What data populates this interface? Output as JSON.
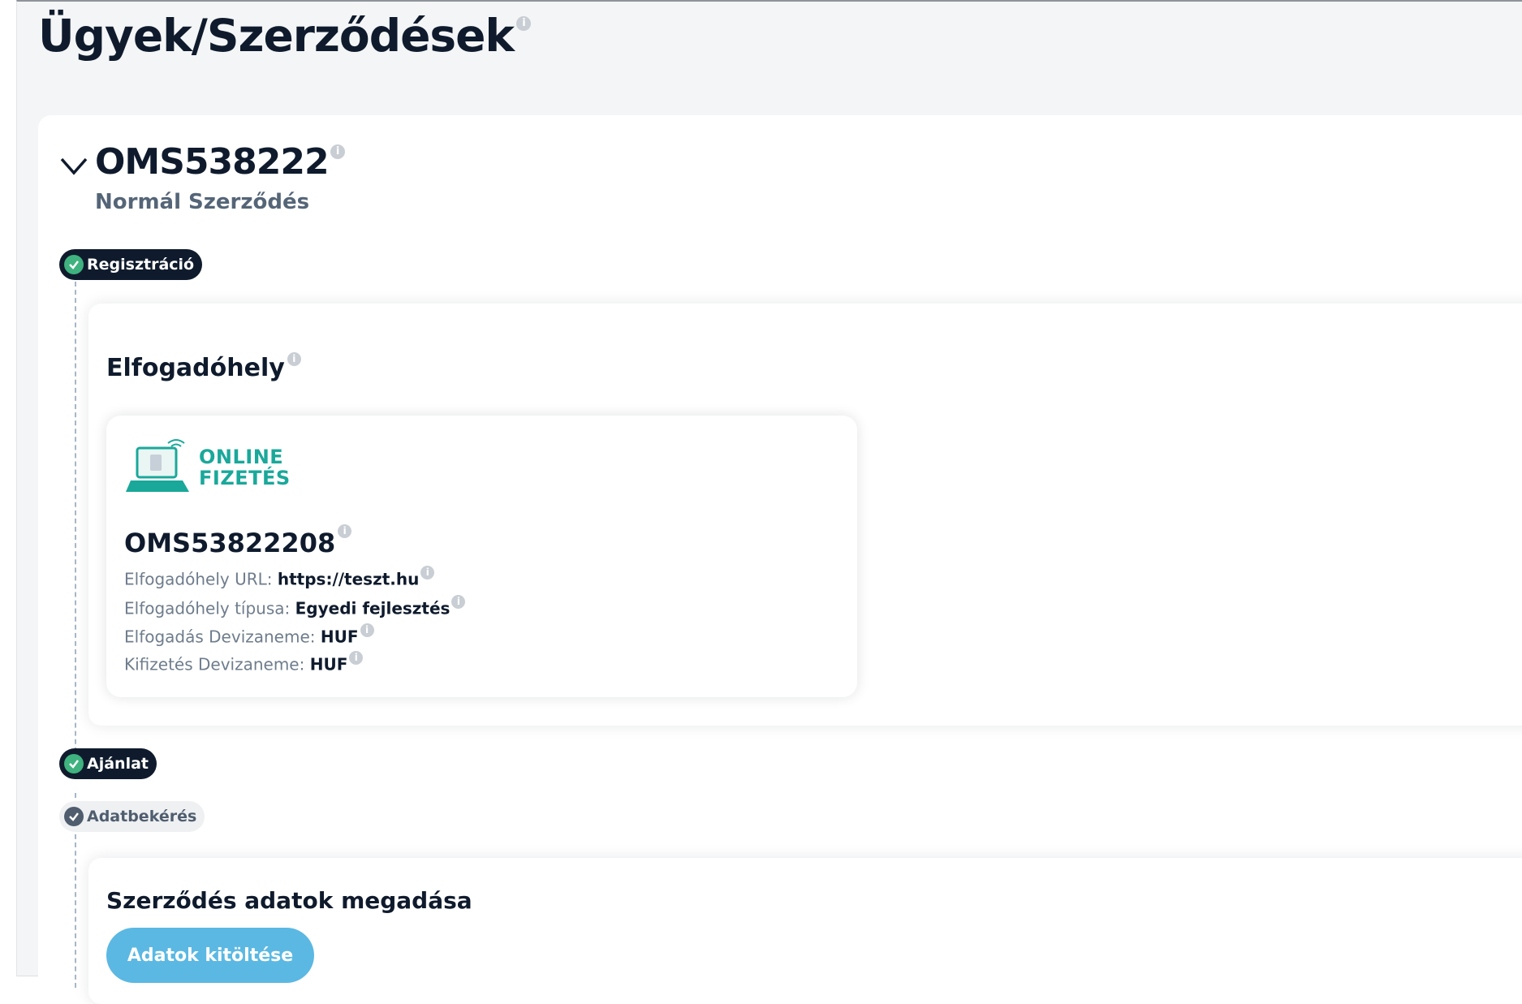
{
  "page": {
    "title": "Ügyek/Szerződések"
  },
  "case": {
    "id": "OMS538222",
    "subtitle": "Normál Szerződés"
  },
  "steps": {
    "registration": "Regisztráció",
    "offer": "Ajánlat",
    "data_request": "Adatbekérés"
  },
  "merchant_section": {
    "title": "Elfogadóhely",
    "logo_line1": "ONLINE",
    "logo_line2": "FIZETÉS",
    "merchant_id": "OMS53822208",
    "fields": [
      {
        "label": "Elfogadóhely URL: ",
        "value": "https://teszt.hu"
      },
      {
        "label": "Elfogadóhely típusa: ",
        "value": "Egyedi fejlesztés"
      },
      {
        "label": "Elfogadás Devizaneme: ",
        "value": "HUF"
      },
      {
        "label": "Kifizetés Devizaneme: ",
        "value": "HUF"
      }
    ]
  },
  "contract_section": {
    "title": "Szerződés adatok megadása",
    "button_label": "Adatok kitöltése"
  },
  "colors": {
    "dark": "#0f1b2d",
    "success": "#3fb27f",
    "button": "#5bb8e3",
    "logo": "#1aa89a"
  },
  "icons": [
    "info-icon",
    "chevron-down-icon",
    "check-circle-icon",
    "laptop-payment-icon"
  ]
}
